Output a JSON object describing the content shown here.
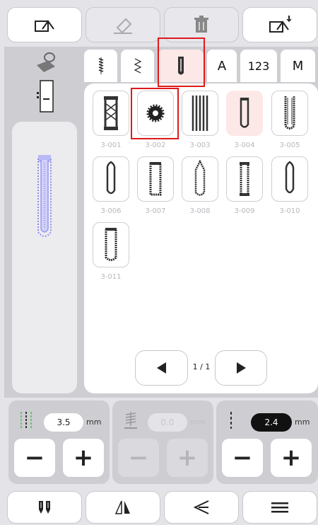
{
  "toolbar": {
    "undo_icon": "undo-icon",
    "eraser_icon": "eraser-icon",
    "trash_icon": "trash-icon",
    "save_icon": "save-download-icon"
  },
  "tabs": [
    {
      "label": "",
      "icon": "straight-stitch-icon"
    },
    {
      "label": "",
      "icon": "zigzag-decorative-icon"
    },
    {
      "label": "",
      "icon": "buttonhole-icon",
      "active": true
    },
    {
      "label": "A"
    },
    {
      "label": "123"
    },
    {
      "label": "M"
    }
  ],
  "stitches": [
    {
      "code": "3-001",
      "icon": "bartack-stitch-icon"
    },
    {
      "code": "3-002",
      "icon": "eyelet-stitch-icon"
    },
    {
      "code": "3-003",
      "icon": "darning-stitch-icon"
    },
    {
      "code": "3-004",
      "icon": "buttonhole-rounded-icon",
      "selected": true
    },
    {
      "code": "3-005",
      "icon": "buttonhole-keyhole-icon"
    },
    {
      "code": "3-006",
      "icon": "buttonhole-round-end-icon"
    },
    {
      "code": "3-007",
      "icon": "buttonhole-square-icon"
    },
    {
      "code": "3-008",
      "icon": "buttonhole-pointed-icon"
    },
    {
      "code": "3-009",
      "icon": "buttonhole-bar-icon"
    },
    {
      "code": "3-010",
      "icon": "buttonhole-oval-icon"
    },
    {
      "code": "3-011",
      "icon": "buttonhole-fringe-icon"
    }
  ],
  "pagination": {
    "text": "1 / 1"
  },
  "controls": {
    "width": {
      "value": "3.5",
      "unit": "mm"
    },
    "density": {
      "value": "0.0",
      "unit": "mm"
    },
    "length": {
      "value": "2.4",
      "unit": "mm"
    }
  },
  "bottom": [
    "needle-icon",
    "mirror-icon",
    "back-arrow-icon",
    "menu-icon"
  ],
  "colors": {
    "accent_red": "#e0191c",
    "selected_bg": "#fde8e8",
    "preview_blue": "#8f8ff0"
  }
}
